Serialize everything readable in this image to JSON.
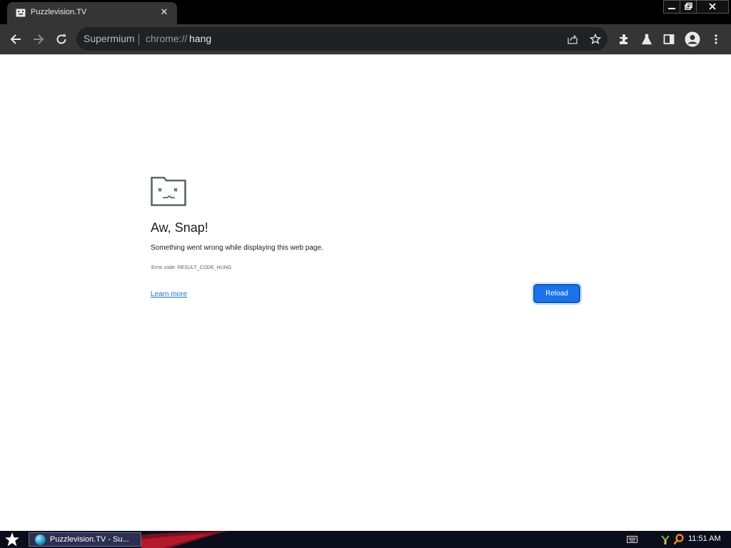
{
  "tab": {
    "title": "Puzzlevision.TV",
    "close_glyph": "✕"
  },
  "omnibox": {
    "browser_name": "Supermium",
    "url_scheme": "chrome://",
    "url_host": "hang"
  },
  "error_page": {
    "title": "Aw, Snap!",
    "message": "Something went wrong while displaying this web page.",
    "error_code": "Error code: RESULT_CODE_HUNG",
    "learn_more": "Learn more",
    "reload_label": "Reload"
  },
  "taskbar": {
    "task_label": "Puzzlevision.TV - Su...",
    "clock": "11:51 AM"
  },
  "colors": {
    "accent": "#1a73e8",
    "toolbar": "#353535",
    "titlebar": "#000000",
    "taskbar": "#0b0e1a"
  },
  "icons": [
    "sad-tab-icon",
    "back-icon",
    "forward-icon",
    "reload-icon",
    "share-icon",
    "star-icon",
    "extensions-icon",
    "labs-icon",
    "side-panel-icon",
    "profile-icon",
    "menu-icon",
    "minimize-icon",
    "restore-icon",
    "close-icon"
  ]
}
